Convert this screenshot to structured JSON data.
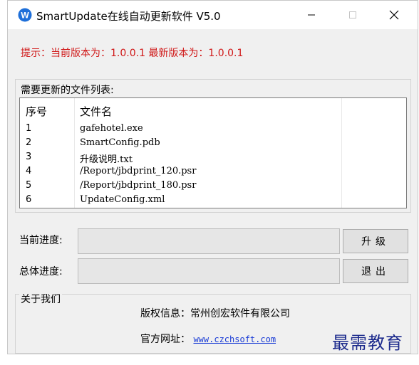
{
  "window": {
    "title": "SmartUpdate在线自动更新软件 V5.0",
    "icon": "app-logo-icon",
    "controls": [
      "minimize-icon",
      "maximize-icon",
      "close-icon"
    ]
  },
  "hint": "提示：当前版本为：1.0.0.1  最新版本为：1.0.0.1",
  "file_list": {
    "legend": "需要更新的文件列表:",
    "columns": [
      "序号",
      "文件名"
    ],
    "rows": [
      {
        "index": "1",
        "name": "gafehotel.exe"
      },
      {
        "index": "2",
        "name": "SmartConfig.pdb"
      },
      {
        "index": "3",
        "name": "升级说明.txt"
      },
      {
        "index": "4",
        "name": "/Report/jbdprint_120.psr"
      },
      {
        "index": "5",
        "name": "/Report/jbdprint_180.psr"
      },
      {
        "index": "6",
        "name": "UpdateConfig.xml"
      }
    ]
  },
  "progress": {
    "current_label": "当前进度:",
    "total_label": "总体进度:",
    "current_value": 0,
    "total_value": 0
  },
  "buttons": {
    "upgrade": "升级",
    "exit": "退出"
  },
  "about": {
    "legend": "关于我们",
    "copyright": "版权信息：常州创宏软件有限公司",
    "website_label": "官方网址：",
    "website_url": "www.czchsoft.com"
  },
  "watermark": "最需教育",
  "colors": {
    "hint": "#d01818",
    "link": "#1a3cd6",
    "watermark": "#1c2a8c",
    "window_bg": "#f0f0f0"
  }
}
